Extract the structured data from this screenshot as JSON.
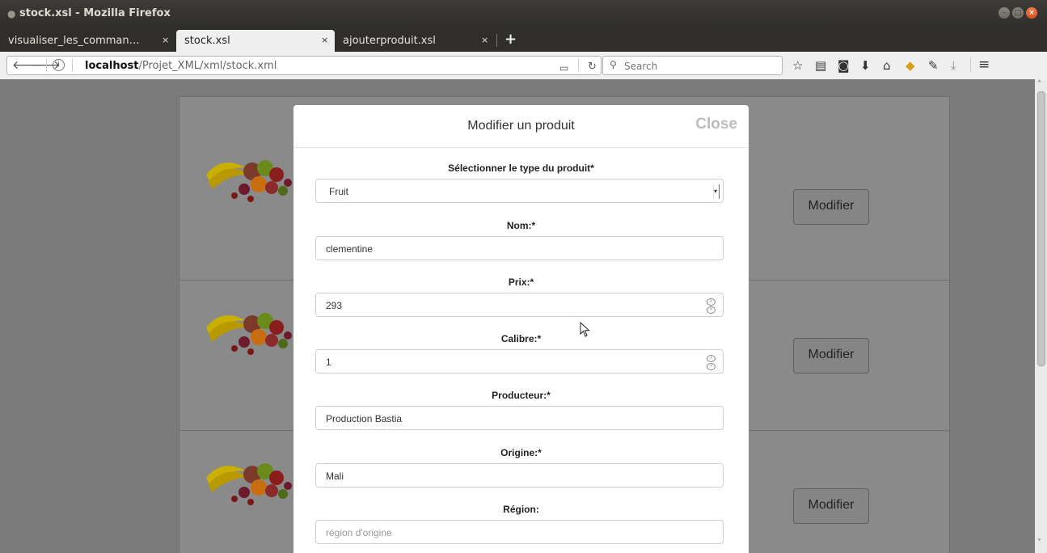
{
  "window": {
    "title": "stock.xsl - Mozilla Firefox"
  },
  "tabs": [
    {
      "label": "visualiser_les_comman…",
      "close": "×"
    },
    {
      "label": "stock.xsl",
      "close": "×"
    },
    {
      "label": "ajouterproduit.xsl",
      "close": "×"
    }
  ],
  "newtab": "+",
  "nav": {
    "url_host": "localhost",
    "url_path": "/Projet_XML/xml/stock.xml",
    "search_placeholder": "Search"
  },
  "page": {
    "modify_buttons": [
      "Modifier",
      "Modifier",
      "Modifier"
    ]
  },
  "modal": {
    "title": "Modifier un produit",
    "close": "Close",
    "type_label": "Sélectionner le type du produit*",
    "type_value": "Fruit",
    "nom_label": "Nom:*",
    "nom_value": "clementine",
    "prix_label": "Prix:*",
    "prix_value": "293",
    "calibre_label": "Calibre:*",
    "calibre_value": "1",
    "producteur_label": "Producteur:*",
    "producteur_value": "Production Bastia",
    "origine_label": "Origine:*",
    "origine_value": "Mali",
    "region_label": "Région:",
    "region_placeholder": "région d'origine"
  },
  "colors": {
    "titlebar": "#3c3b37",
    "overlay_bg": "#7b7b7b",
    "close_button": "#e0582a"
  }
}
